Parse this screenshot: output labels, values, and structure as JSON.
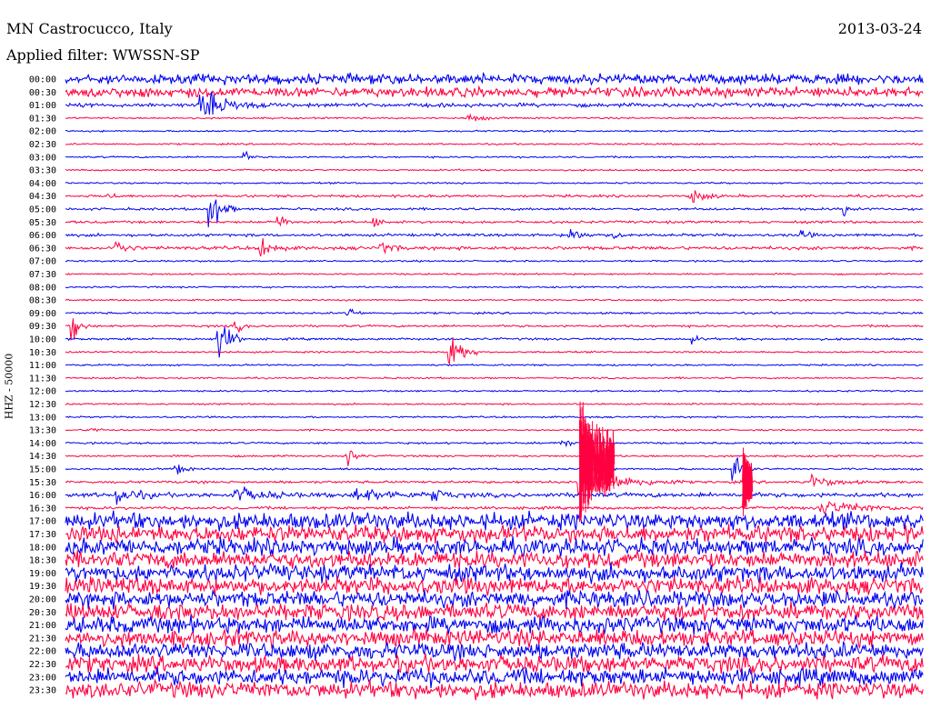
{
  "header": {
    "station": "MN Castrocucco, Italy",
    "filter": "Applied filter: WWSSN-SP",
    "date": "2013-03-24"
  },
  "chart_data": {
    "type": "line",
    "title": "MN Castrocucco, Italy",
    "subtitle": "Applied filter: WWSSN-SP",
    "date": "2013-03-24",
    "ylabel": "HHZ - 50000",
    "colors": [
      "#0000ee",
      "#ff0040"
    ],
    "rows": [
      {
        "time": "00:00",
        "noise": 3.5
      },
      {
        "time": "00:30",
        "noise": 3.5
      },
      {
        "time": "01:00",
        "noise": 1.4,
        "events": [
          {
            "at": 0.16,
            "amp": 10,
            "dur": 0.08
          }
        ]
      },
      {
        "time": "01:30",
        "noise": 0.6,
        "events": [
          {
            "at": 0.47,
            "amp": 3,
            "dur": 0.04
          }
        ]
      },
      {
        "time": "02:00",
        "noise": 0.6
      },
      {
        "time": "02:30",
        "noise": 0.6
      },
      {
        "time": "03:00",
        "noise": 0.6,
        "events": [
          {
            "at": 0.21,
            "amp": 3,
            "dur": 0.02
          }
        ]
      },
      {
        "time": "03:30",
        "noise": 0.6
      },
      {
        "time": "04:00",
        "noise": 0.6
      },
      {
        "time": "04:30",
        "noise": 0.9,
        "events": [
          {
            "at": 0.05,
            "amp": 3,
            "dur": 0.02
          },
          {
            "at": 0.73,
            "amp": 5,
            "dur": 0.04
          }
        ]
      },
      {
        "time": "05:00",
        "noise": 0.9,
        "events": [
          {
            "at": 0.17,
            "amp": 18,
            "dur": 0.03
          },
          {
            "at": 0.91,
            "amp": 5,
            "dur": 0.02
          }
        ]
      },
      {
        "time": "05:30",
        "noise": 0.9,
        "events": [
          {
            "at": 0.25,
            "amp": 6,
            "dur": 0.02
          },
          {
            "at": 0.36,
            "amp": 4,
            "dur": 0.02
          }
        ]
      },
      {
        "time": "06:00",
        "noise": 1.0,
        "events": [
          {
            "at": 0.59,
            "amp": 6,
            "dur": 0.03
          },
          {
            "at": 0.64,
            "amp": 4,
            "dur": 0.02
          },
          {
            "at": 0.86,
            "amp": 3,
            "dur": 0.02
          }
        ]
      },
      {
        "time": "06:30",
        "noise": 1.2,
        "events": [
          {
            "at": 0.06,
            "amp": 6,
            "dur": 0.03
          },
          {
            "at": 0.23,
            "amp": 8,
            "dur": 0.03
          },
          {
            "at": 0.37,
            "amp": 4,
            "dur": 0.03
          }
        ]
      },
      {
        "time": "07:00",
        "noise": 0.6
      },
      {
        "time": "07:30",
        "noise": 0.6
      },
      {
        "time": "08:00",
        "noise": 0.6
      },
      {
        "time": "08:30",
        "noise": 0.6
      },
      {
        "time": "09:00",
        "noise": 0.7,
        "events": [
          {
            "at": 0.33,
            "amp": 5,
            "dur": 0.02
          }
        ]
      },
      {
        "time": "09:30",
        "noise": 0.8,
        "events": [
          {
            "at": 0.01,
            "amp": 10,
            "dur": 0.02
          },
          {
            "at": 0.2,
            "amp": 4,
            "dur": 0.02
          }
        ]
      },
      {
        "time": "10:00",
        "noise": 0.8,
        "events": [
          {
            "at": 0.18,
            "amp": 16,
            "dur": 0.03
          },
          {
            "at": 0.73,
            "amp": 3,
            "dur": 0.02
          }
        ]
      },
      {
        "time": "10:30",
        "noise": 0.6,
        "events": [
          {
            "at": 0.45,
            "amp": 20,
            "dur": 0.03
          }
        ]
      },
      {
        "time": "11:00",
        "noise": 0.6
      },
      {
        "time": "11:30",
        "noise": 0.6
      },
      {
        "time": "12:00",
        "noise": 0.6
      },
      {
        "time": "12:30",
        "noise": 0.6
      },
      {
        "time": "13:00",
        "noise": 0.6
      },
      {
        "time": "13:30",
        "noise": 0.6,
        "events": [
          {
            "at": 0.03,
            "amp": 3,
            "dur": 0.02
          }
        ]
      },
      {
        "time": "14:00",
        "noise": 0.7,
        "events": [
          {
            "at": 0.58,
            "amp": 4,
            "dur": 0.02
          }
        ]
      },
      {
        "time": "14:30",
        "noise": 0.7,
        "events": [
          {
            "at": 0.33,
            "amp": 6,
            "dur": 0.02
          }
        ]
      },
      {
        "time": "15:00",
        "noise": 0.7,
        "events": [
          {
            "at": 0.13,
            "amp": 6,
            "dur": 0.02
          },
          {
            "at": 0.78,
            "amp": 12,
            "dur": 0.03
          }
        ]
      },
      {
        "time": "15:30",
        "noise": 0.9,
        "events": [
          {
            "at": 0.6,
            "amp": 12,
            "dur": 0.12
          },
          {
            "at": 0.87,
            "amp": 5,
            "dur": 0.06
          }
        ]
      },
      {
        "time": "16:00",
        "noise": 1.6,
        "events": [
          {
            "at": 0.06,
            "amp": 6,
            "dur": 0.06
          },
          {
            "at": 0.2,
            "amp": 5,
            "dur": 0.08
          },
          {
            "at": 0.34,
            "amp": 5,
            "dur": 0.1
          },
          {
            "at": 0.43,
            "amp": 5,
            "dur": 0.03
          }
        ]
      },
      {
        "time": "16:30",
        "noise": 1.0,
        "events": [
          {
            "at": 0.88,
            "amp": 6,
            "dur": 0.12
          }
        ]
      },
      {
        "time": "17:00",
        "noise": 6
      },
      {
        "time": "17:30",
        "noise": 6
      },
      {
        "time": "18:00",
        "noise": 6
      },
      {
        "time": "18:30",
        "noise": 6
      },
      {
        "time": "19:00",
        "noise": 6
      },
      {
        "time": "19:30",
        "noise": 6
      },
      {
        "time": "20:00",
        "noise": 6
      },
      {
        "time": "20:30",
        "noise": 6
      },
      {
        "time": "21:00",
        "noise": 6
      },
      {
        "time": "21:30",
        "noise": 6
      },
      {
        "time": "22:00",
        "noise": 6
      },
      {
        "time": "22:30",
        "noise": 6
      },
      {
        "time": "23:00",
        "noise": 6
      },
      {
        "time": "23:30",
        "noise": 6
      }
    ],
    "main_event": {
      "at": 0.6,
      "start_row": "12:30",
      "end_row": "17:00"
    },
    "aftershock": {
      "at": 0.79,
      "start_row": "14:30",
      "end_row": "16:30"
    }
  }
}
